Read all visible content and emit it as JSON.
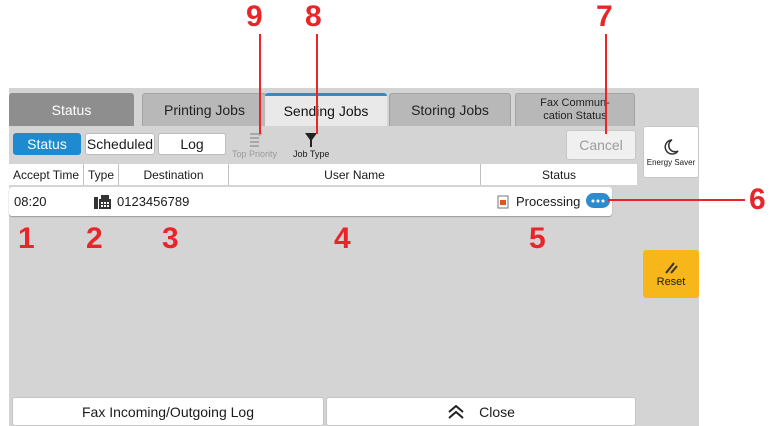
{
  "tabs": [
    {
      "label": "Status"
    },
    {
      "label": "Printing Jobs"
    },
    {
      "label": "Sending Jobs"
    },
    {
      "label": "Storing Jobs"
    },
    {
      "label": "Fax Commun-\ncation Status"
    }
  ],
  "sub_tabs": {
    "status": "Status",
    "scheduled": "Scheduled",
    "log": "Log"
  },
  "toolbar": {
    "top_priority": "Top Priority",
    "job_type": "Job Type",
    "cancel": "Cancel"
  },
  "table": {
    "headers": [
      "Accept Time",
      "Type",
      "Destination",
      "User Name",
      "Status"
    ],
    "rows": [
      {
        "time": "08:20",
        "type_icon": "fax-icon",
        "destination": "0123456789",
        "user": "",
        "status": "Processing"
      }
    ]
  },
  "side": {
    "energy_saver": "Energy Saver",
    "reset": "Reset"
  },
  "bottom": {
    "fax_log": "Fax Incoming/Outgoing Log",
    "close": "Close"
  },
  "callouts": {
    "c1": "1",
    "c2": "2",
    "c3": "3",
    "c4": "4",
    "c5": "5",
    "c6": "6",
    "c7": "7",
    "c8": "8",
    "c9": "9"
  },
  "colors": {
    "accent": "#1e8bd0",
    "callout": "#e8262a",
    "reset": "#f7b71a"
  }
}
